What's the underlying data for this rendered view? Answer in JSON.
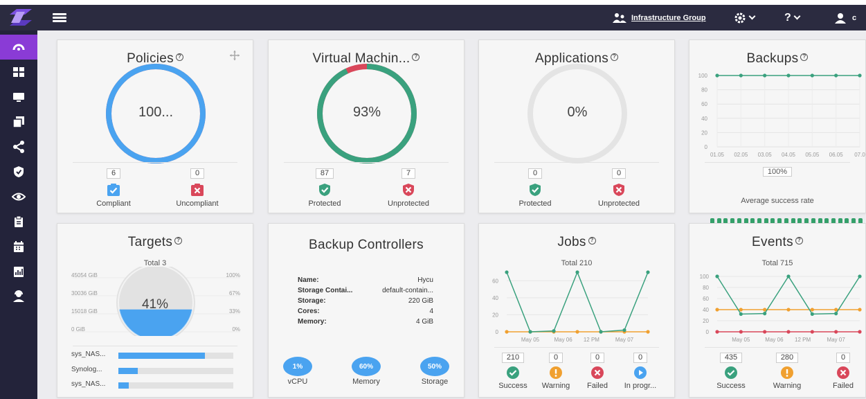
{
  "topbar": {
    "group_label": "Infrastructure Group",
    "help_label": "?",
    "user_label": "c"
  },
  "sidebar": {
    "items": [
      {
        "icon": "dashboard-gauge-icon",
        "active": true
      },
      {
        "icon": "grid-icon"
      },
      {
        "icon": "monitor-icon"
      },
      {
        "icon": "layers-icon"
      },
      {
        "icon": "share-icon"
      },
      {
        "icon": "shield-icon"
      },
      {
        "icon": "eye-icon"
      },
      {
        "icon": "clipboard-icon"
      },
      {
        "icon": "calendar-icon"
      },
      {
        "icon": "report-icon"
      },
      {
        "icon": "user-support-icon"
      }
    ]
  },
  "policies": {
    "title": "Policies",
    "value": "100...",
    "compliant_count": "6",
    "compliant_label": "Compliant",
    "uncompliant_count": "0",
    "uncompliant_label": "Uncompliant",
    "fraction": 1.0
  },
  "vms": {
    "title": "Virtual Machin...",
    "value": "93%",
    "protected_count": "87",
    "protected_label": "Protected",
    "unprotected_count": "7",
    "unprotected_label": "Unprotected",
    "fraction": 0.93
  },
  "applications": {
    "title": "Applications",
    "value": "0%",
    "protected_count": "0",
    "protected_label": "Protected",
    "unprotected_count": "0",
    "unprotected_label": "Unprotected",
    "fraction": 0
  },
  "backups": {
    "title": "Backups",
    "rate": "100%",
    "rate_label": "Average success rate",
    "chart_data": {
      "type": "line",
      "x": [
        "01.05",
        "02.05",
        "03.05",
        "04.05",
        "05.05",
        "06.05",
        "07.0"
      ],
      "series": [
        {
          "values": [
            100,
            100,
            100,
            100,
            100,
            100,
            100
          ]
        }
      ],
      "yticks": [
        0,
        20,
        40,
        60,
        80,
        100
      ],
      "ylim": [
        0,
        100
      ]
    }
  },
  "targets": {
    "title": "Targets",
    "total": "Total 3",
    "value": "41%",
    "fraction": 0.41,
    "left_ticks": [
      "45054 GiB",
      "30036 GiB",
      "15018 GiB",
      "0 GiB"
    ],
    "right_ticks": [
      "100%",
      "67%",
      "33%",
      "0%"
    ],
    "bars": [
      {
        "name": "sys_NAS...",
        "fraction": 0.75
      },
      {
        "name": "Synolog...",
        "fraction": 0.17
      },
      {
        "name": "sys_NAS...",
        "fraction": 0.09
      }
    ]
  },
  "controllers": {
    "title": "Backup Controllers",
    "rows": [
      {
        "k": "Name:",
        "v": "Hycu"
      },
      {
        "k": "Storage Contai...",
        "v": "default-contain..."
      },
      {
        "k": "Storage:",
        "v": "220 GiB"
      },
      {
        "k": "Cores:",
        "v": "4"
      },
      {
        "k": "Memory:",
        "v": "4 GiB"
      }
    ],
    "vcpu": "1%",
    "vcpu_label": "vCPU",
    "memory": "60%",
    "memory_label": "Memory",
    "storage": "50%",
    "storage_label": "Storage"
  },
  "jobs": {
    "title": "Jobs",
    "total": "Total 210",
    "success": "210",
    "success_label": "Success",
    "warning": "0",
    "warning_label": "Warning",
    "failed": "0",
    "failed_label": "Failed",
    "inprogress": "0",
    "inprogress_label": "In progr...",
    "chart_data": {
      "type": "line",
      "x_ticks": [
        "May 05",
        "May 06",
        "12 PM",
        "May 07"
      ],
      "yticks": [
        0,
        20,
        40,
        60
      ],
      "ylim": [
        0,
        70
      ],
      "series": [
        {
          "color": "#3aa17e",
          "values": [
            70,
            0,
            1,
            70,
            0,
            2,
            70
          ]
        },
        {
          "color": "#f0a030",
          "values": [
            0,
            0,
            0,
            0,
            0,
            0,
            0
          ]
        }
      ]
    }
  },
  "events": {
    "title": "Events",
    "total": "Total 715",
    "success": "435",
    "success_label": "Success",
    "warning": "280",
    "warning_label": "Warning",
    "failed": "0",
    "failed_label": "Failed",
    "chart_data": {
      "type": "line",
      "x_ticks": [
        "May 05",
        "May 06",
        "12 PM",
        "May 07"
      ],
      "yticks": [
        0,
        20,
        40,
        60,
        80,
        100
      ],
      "ylim": [
        0,
        100
      ],
      "series": [
        {
          "color": "#3aa17e",
          "values": [
            100,
            32,
            33,
            100,
            32,
            33,
            100
          ]
        },
        {
          "color": "#f0a030",
          "values": [
            40,
            40,
            40,
            40,
            40,
            40,
            40
          ]
        },
        {
          "color": "#d9475a",
          "values": [
            0,
            0,
            0,
            0,
            0,
            0,
            0
          ]
        }
      ]
    }
  },
  "colors": {
    "blue": "#4aa3f0",
    "green": "#3aa17e",
    "red": "#d9475a",
    "orange": "#f0a030",
    "purple": "#8a3bd6",
    "dark": "#2b2b40"
  }
}
